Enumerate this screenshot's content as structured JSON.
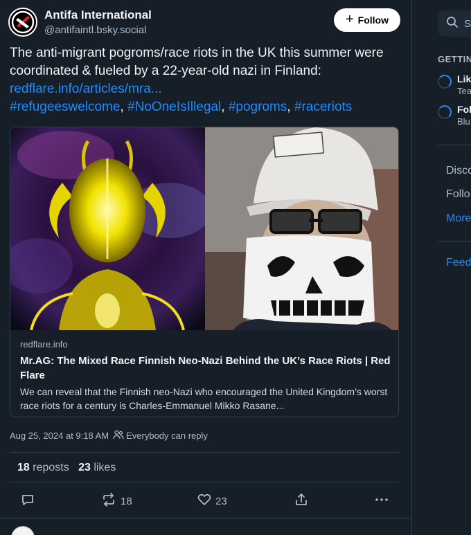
{
  "post": {
    "author": {
      "display_name": "Antifa International",
      "handle": "@antifaintl.bsky.social"
    },
    "follow_label": "Follow",
    "text": "The anti-migrant pogroms/race riots in the UK this summer were coordinated & fueled by a 22-year-old nazi in Finland:",
    "link": "redflare.info/articles/mra...",
    "hashtags": [
      "#refugeeswelcome",
      "#NoOneIsIllegal",
      "#pogroms",
      "#raceriots"
    ],
    "embed": {
      "domain": "redflare.info",
      "title": "Mr.AG: The Mixed Race Finnish Neo-Nazi Behind the UK’s Race Riots | Red Flare",
      "description": "We can reveal that the Finnish neo-Nazi who encouraged the United Kingdom’s worst race riots for a century is Charles-Emmanuel Mikko Rasane..."
    },
    "timestamp": "Aug 25, 2024 at 9:18 AM",
    "reply_setting": "Everybody can reply",
    "stats": {
      "reposts_count": "18",
      "reposts_label": "reposts",
      "likes_count": "23",
      "likes_label": "likes"
    },
    "actions": {
      "repost_count": "18",
      "like_count": "23"
    }
  },
  "sidebar": {
    "search_placeholder": "S",
    "getting_started_label": "GETTIN",
    "tasks": [
      {
        "title": "Lik",
        "subtitle": "Tea"
      },
      {
        "title": "Fol",
        "subtitle": "Blu"
      }
    ],
    "links": [
      "Disco",
      "Follo",
      "More"
    ],
    "feedback": "Feedb"
  },
  "colors": {
    "background": "#161e27",
    "link": "#208bfe",
    "muted": "#aebbc9",
    "border": "#2e4052"
  }
}
